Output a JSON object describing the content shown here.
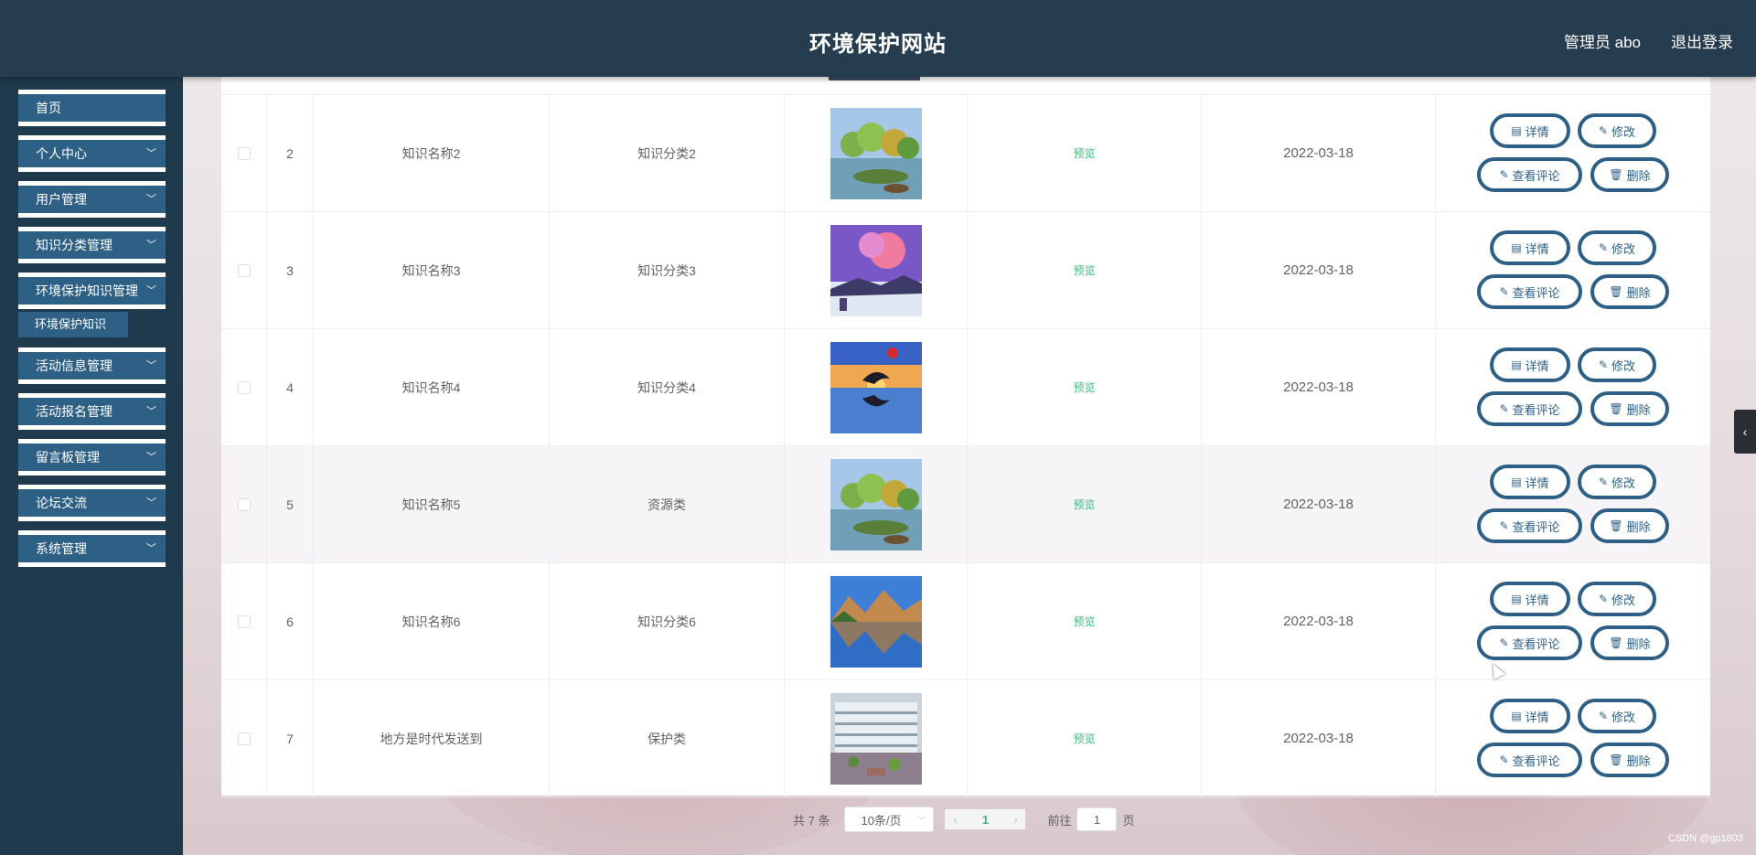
{
  "header": {
    "title": "环境保护网站",
    "admin_label": "管理员 abo",
    "logout_label": "退出登录"
  },
  "sidebar": {
    "items": [
      {
        "label": "首页",
        "has_chevron": false
      },
      {
        "label": "个人中心",
        "has_chevron": true
      },
      {
        "label": "用户管理",
        "has_chevron": true
      },
      {
        "label": "知识分类管理",
        "has_chevron": true
      },
      {
        "label": "环境保护知识管理",
        "has_chevron": true
      },
      {
        "label": "活动信息管理",
        "has_chevron": true
      },
      {
        "label": "活动报名管理",
        "has_chevron": true
      },
      {
        "label": "留言板管理",
        "has_chevron": true
      },
      {
        "label": "论坛交流",
        "has_chevron": true
      },
      {
        "label": "系统管理",
        "has_chevron": true
      }
    ],
    "subitem": "环境保护知识"
  },
  "table": {
    "rows": [
      {
        "index": "2",
        "name": "知识名称2",
        "category": "知识分类2",
        "image": "lake-trees",
        "preview": "预览",
        "date": "2022-03-18"
      },
      {
        "index": "3",
        "name": "知识名称3",
        "category": "知识分类3",
        "image": "purple-sky",
        "preview": "预览",
        "date": "2022-03-18"
      },
      {
        "index": "4",
        "name": "知识名称4",
        "category": "知识分类4",
        "image": "sunset-dolphin",
        "preview": "预览",
        "date": "2022-03-18"
      },
      {
        "index": "5",
        "name": "知识名称5",
        "category": "资源类",
        "image": "lake-trees",
        "preview": "预览",
        "date": "2022-03-18"
      },
      {
        "index": "6",
        "name": "知识名称6",
        "category": "知识分类6",
        "image": "mountain-lake",
        "preview": "预览",
        "date": "2022-03-18"
      },
      {
        "index": "7",
        "name": "地方是时代发送到",
        "category": "保护类",
        "image": "building-courtyard",
        "preview": "预览",
        "date": "2022-03-18"
      }
    ],
    "actions": {
      "detail": "详情",
      "edit": "修改",
      "comments": "查看评论",
      "delete": "删除"
    }
  },
  "pagination": {
    "total": "共 7 条",
    "page_size": "10条/页",
    "current_page": "1",
    "goto_label": "前往",
    "goto_value": "1",
    "page_suffix": "页"
  },
  "watermark": "CSDN @gp1803",
  "colors": {
    "header_bg": "#253d4f",
    "sidebar_bg": "#203a4d",
    "menu_item_bg": "#2e5f85",
    "accent_green": "#3cb87a"
  }
}
